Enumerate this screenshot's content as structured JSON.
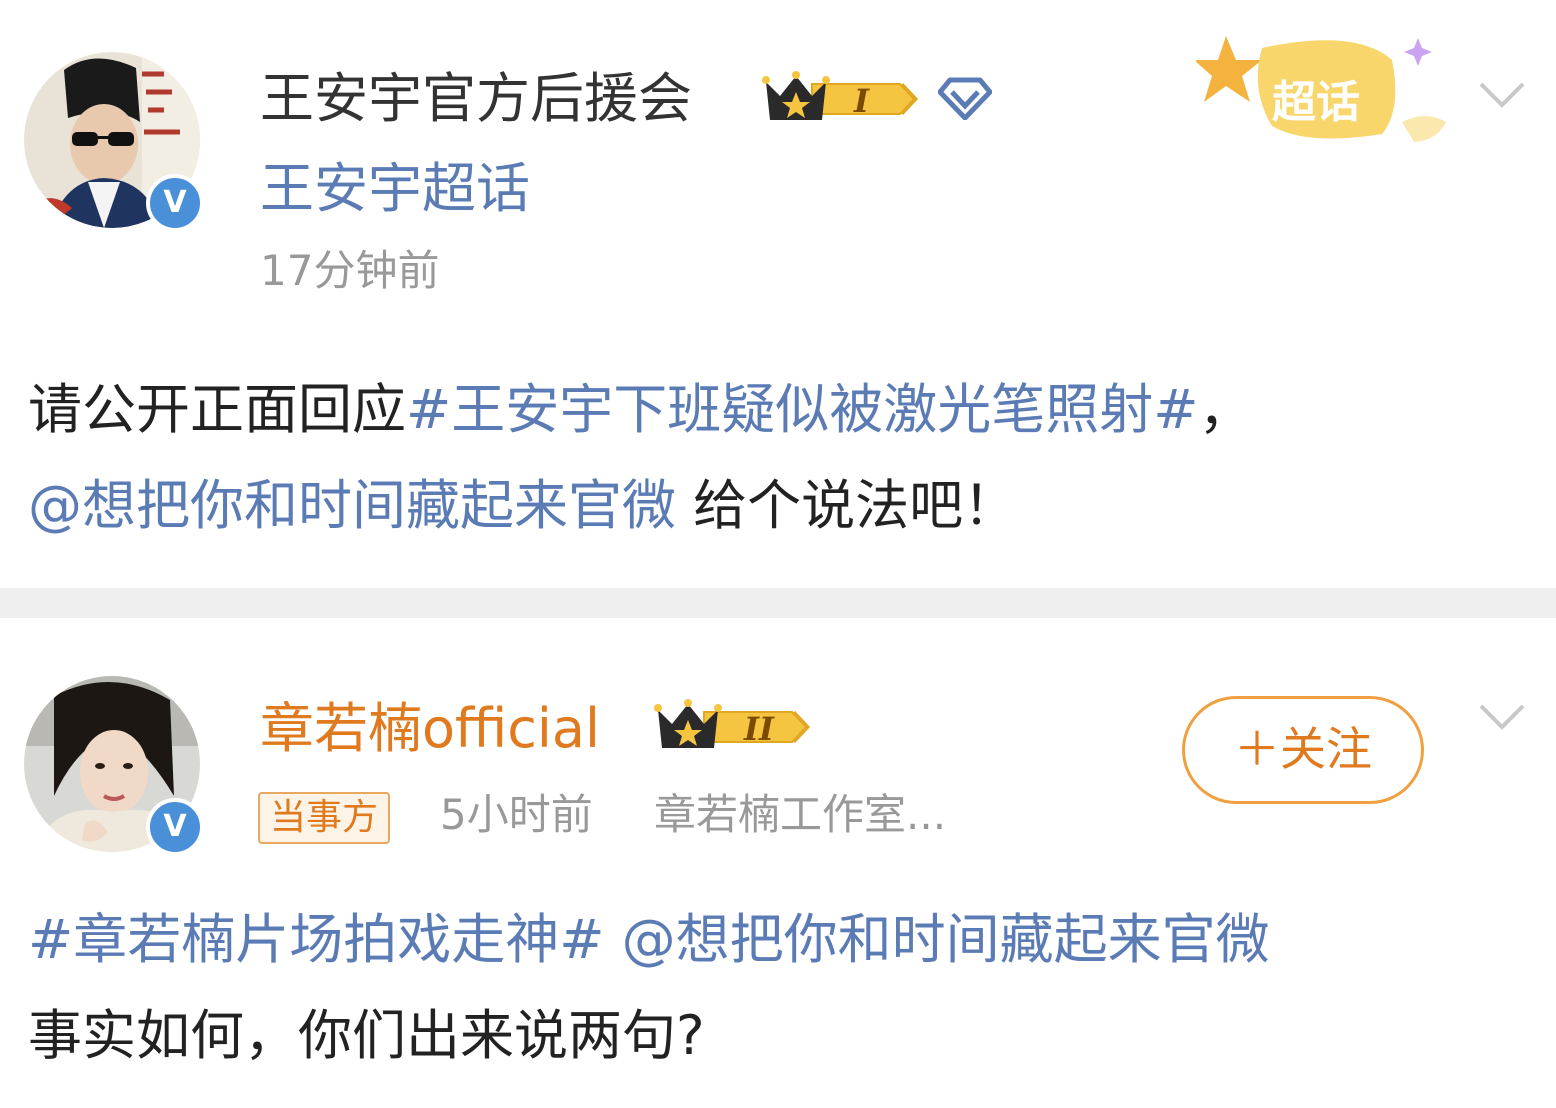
{
  "post1": {
    "author": "王安宇官方后援会",
    "rank_badge": "I",
    "super_topic_link": "王安宇超话",
    "time": "17分钟前",
    "super_topic_tag": "超话",
    "body_prefix": "请公开正面回应",
    "hashtag": "#王安宇下班疑似被激光笔照射#",
    "body_mid": "，",
    "mention": "@想把你和时间藏起来官微",
    "body_suffix": " 给个说法吧！",
    "icons": [
      "crown-icon",
      "diamond-icon",
      "verified-icon",
      "chevron-down-icon"
    ]
  },
  "post2": {
    "author": "章若楠official",
    "rank_badge": "II",
    "party_tag": "当事方",
    "time": "5小时前",
    "source": "章若楠工作室...",
    "follow_label": "＋关注",
    "hashtag": "#章若楠片场拍戏走神#",
    "mention": " @想把你和时间藏起来官微",
    "body_suffix": "事实如何，你们出来说两句?",
    "icons": [
      "crown-icon",
      "verified-icon",
      "chevron-down-icon"
    ]
  },
  "colors": {
    "link": "#5b7bb5",
    "vip_name": "#e07a1f",
    "badge_gold": "#f5c542",
    "follow_border": "#f0a040",
    "verified": "#4a90d9"
  }
}
